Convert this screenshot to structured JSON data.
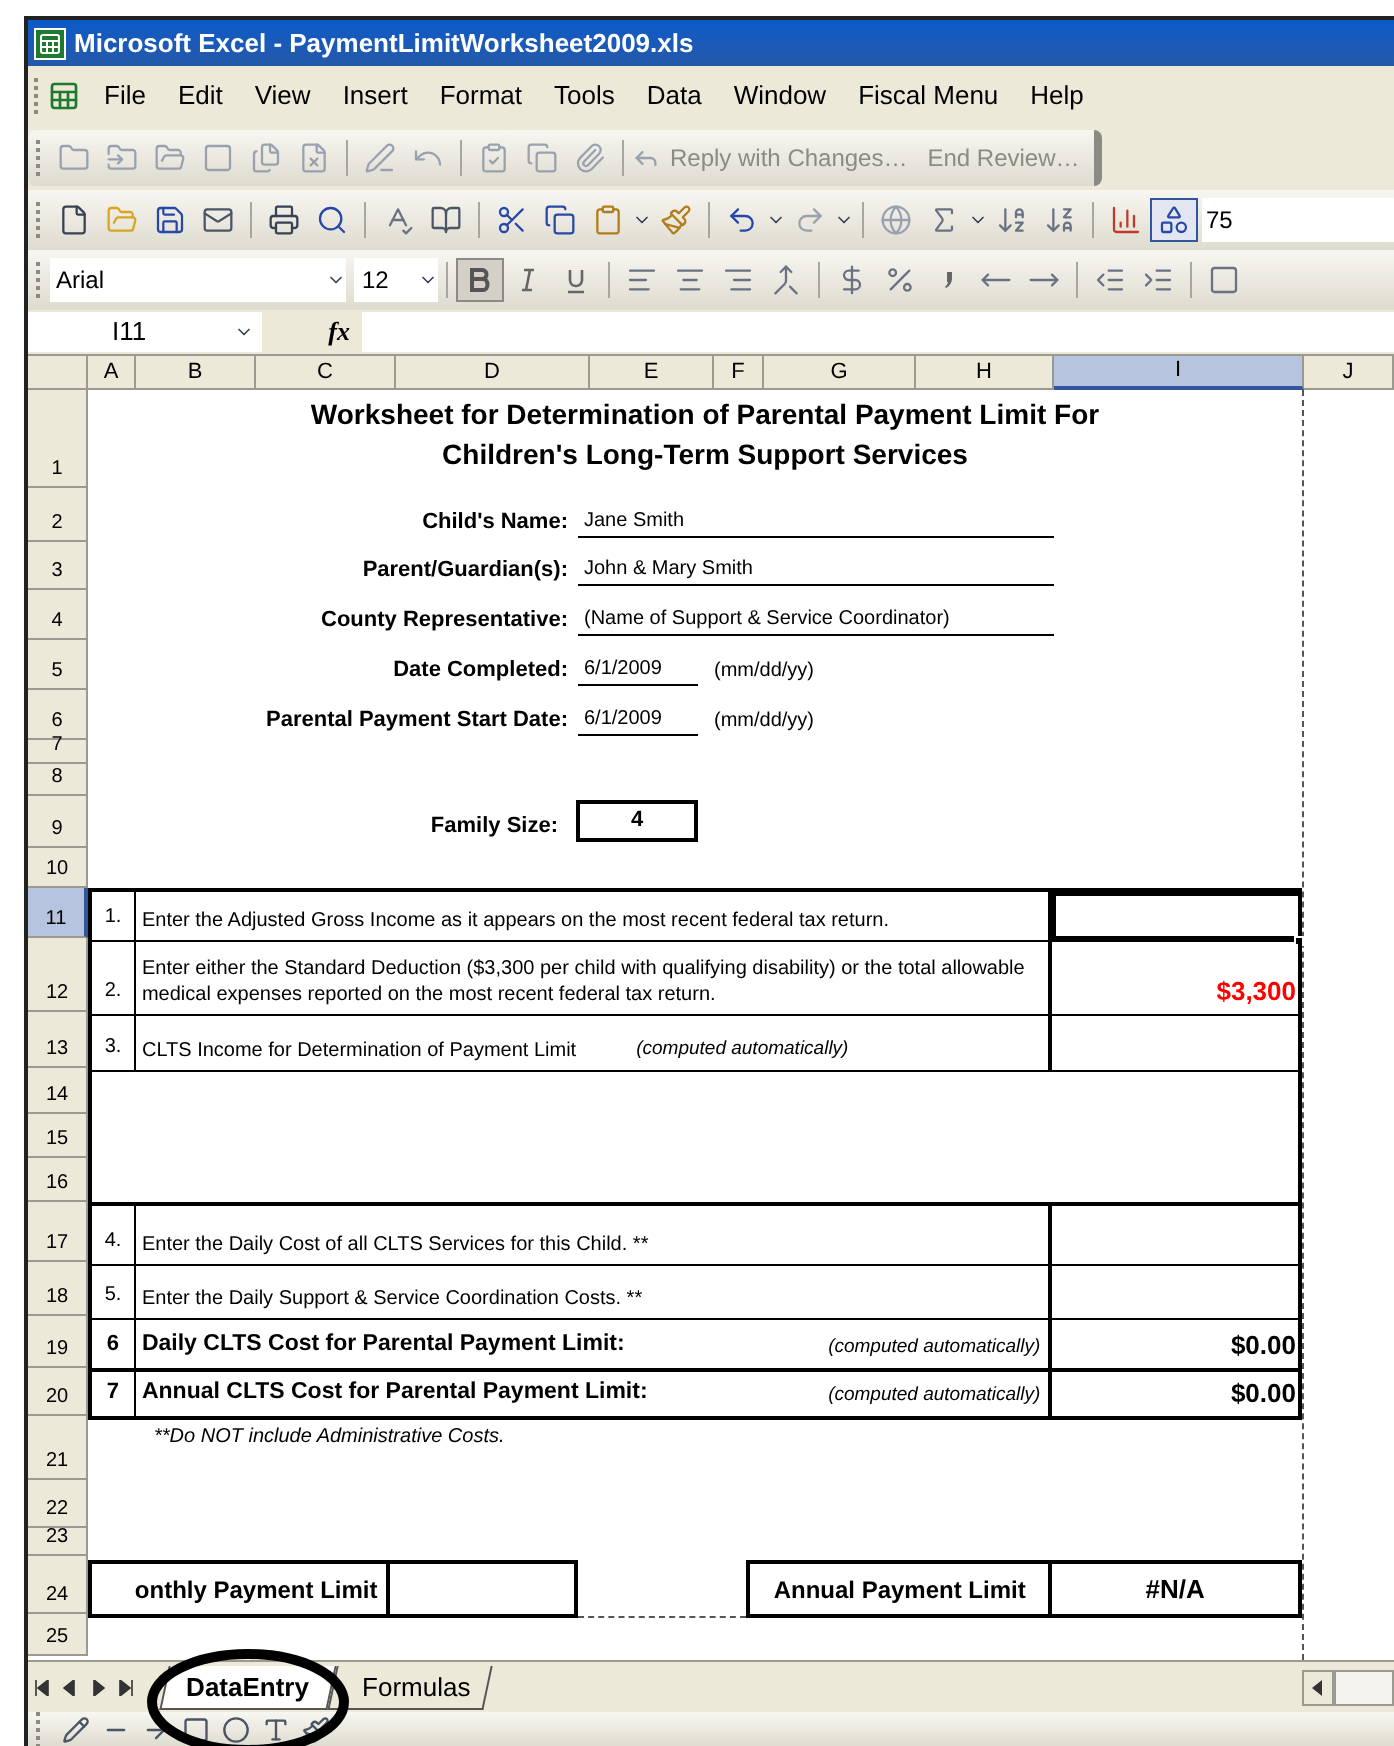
{
  "window": {
    "title": "Microsoft Excel - PaymentLimitWorksheet2009.xls"
  },
  "menu": [
    "File",
    "Edit",
    "View",
    "Insert",
    "Format",
    "Tools",
    "Data",
    "Window",
    "Fiscal Menu",
    "Help"
  ],
  "reviewing_toolbar": {
    "buttons": [
      "Reply with Changes…",
      "End Review…"
    ]
  },
  "standard_toolbar": {
    "zoom": "75"
  },
  "formatting_toolbar": {
    "font": "Arial",
    "size": "12",
    "bold": true,
    "italic": false,
    "underline": false
  },
  "formula_bar": {
    "name_box": "I11",
    "fx": "fx"
  },
  "columns": [
    {
      "label": "A",
      "selected": false
    },
    {
      "label": "B",
      "selected": false
    },
    {
      "label": "C",
      "selected": false
    },
    {
      "label": "D",
      "selected": false
    },
    {
      "label": "E",
      "selected": false
    },
    {
      "label": "F",
      "selected": false
    },
    {
      "label": "G",
      "selected": false
    },
    {
      "label": "H",
      "selected": false
    },
    {
      "label": "I",
      "selected": true
    },
    {
      "label": "J",
      "selected": false
    }
  ],
  "row_headers": [
    {
      "label": "1",
      "selected": false
    },
    {
      "label": "2",
      "selected": false
    },
    {
      "label": "3",
      "selected": false
    },
    {
      "label": "4",
      "selected": false
    },
    {
      "label": "5",
      "selected": false
    },
    {
      "label": "6",
      "selected": false
    },
    {
      "label": "7",
      "selected": false
    },
    {
      "label": "8",
      "selected": false
    },
    {
      "label": "9",
      "selected": false
    },
    {
      "label": "10",
      "selected": false
    },
    {
      "label": "11",
      "selected": true
    },
    {
      "label": "12",
      "selected": false
    },
    {
      "label": "13",
      "selected": false
    },
    {
      "label": "14",
      "selected": false
    },
    {
      "label": "15",
      "selected": false
    },
    {
      "label": "16",
      "selected": false
    },
    {
      "label": "17",
      "selected": false
    },
    {
      "label": "18",
      "selected": false
    },
    {
      "label": "19",
      "selected": false
    },
    {
      "label": "20",
      "selected": false
    },
    {
      "label": "21",
      "selected": false
    },
    {
      "label": "22",
      "selected": false
    },
    {
      "label": "23",
      "selected": false
    },
    {
      "label": "24",
      "selected": false
    },
    {
      "label": "25",
      "selected": false
    }
  ],
  "sheet": {
    "title": [
      "Worksheet for Determination of Parental Payment Limit For",
      "Children's Long-Term Support Services"
    ],
    "fields": [
      {
        "kind": "long",
        "label": "Child's Name:",
        "value": "Jane Smith"
      },
      {
        "kind": "long",
        "label": "Parent/Guardian(s):",
        "value": "John & Mary Smith"
      },
      {
        "kind": "long",
        "label": "County Representative:",
        "value": "(Name of Support & Service Coordinator)"
      },
      {
        "kind": "date",
        "label": "Date Completed:",
        "value": "6/1/2009",
        "hint": "(mm/dd/yy)"
      },
      {
        "kind": "date",
        "label": "Parental Payment Start Date:",
        "value": "6/1/2009",
        "hint": "(mm/dd/yy)"
      }
    ],
    "family_size": {
      "label": "Family Size:",
      "value": "4"
    },
    "items_top": [
      {
        "kind": "entry",
        "number": "1.",
        "text": "Enter the Adjusted Gross Income as it appears on the most recent federal tax return.",
        "selected": true
      },
      {
        "kind": "default",
        "number": "2.",
        "text": "Enter either the Standard Deduction ($3,300 per child with qualifying disability) or the total allowable medical expenses reported on the most recent federal tax return.",
        "value": "$3,300",
        "selected": false
      },
      {
        "kind": "computed",
        "number": "3.",
        "text": "CLTS Income for Determination of Payment Limit",
        "note": "(computed automatically)",
        "selected": false
      }
    ],
    "items_bottom": [
      {
        "kind": "entry",
        "number": "4.",
        "text": "Enter the Daily Cost of all CLTS Services for this Child. **",
        "selected": false
      },
      {
        "kind": "entry",
        "number": "5.",
        "text": "Enter the Daily Support & Service Coordination Costs. **",
        "selected": false
      },
      {
        "kind": "total",
        "number": "6",
        "text": "Daily CLTS Cost for Parental Payment Limit:",
        "note": "(computed automatically)",
        "value": "$0.00",
        "selected": false
      },
      {
        "kind": "total",
        "number": "7",
        "text": "Annual CLTS Cost for Parental Payment Limit:",
        "note": "(computed automatically)",
        "value": "$0.00",
        "selected": false
      }
    ],
    "footnote": "**Do NOT include Administrative Costs.",
    "monthly_limit": {
      "label": "onthly Payment Limit"
    },
    "annual_limit": {
      "label": "Annual Payment Limit",
      "value": "#N/A"
    }
  },
  "sheet_tabs": [
    {
      "label": "DataEntry",
      "selected": true
    },
    {
      "label": "Formulas",
      "selected": false
    }
  ]
}
